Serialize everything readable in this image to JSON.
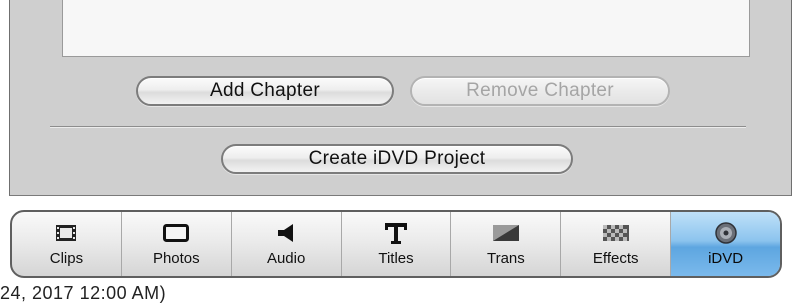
{
  "chapters_panel": {
    "add_chapter_label": "Add Chapter",
    "remove_chapter_label": "Remove Chapter",
    "create_project_label": "Create iDVD Project"
  },
  "toolbar": {
    "tabs": [
      {
        "label": "Clips",
        "icon": "clips-icon"
      },
      {
        "label": "Photos",
        "icon": "photos-icon"
      },
      {
        "label": "Audio",
        "icon": "audio-icon"
      },
      {
        "label": "Titles",
        "icon": "titles-icon"
      },
      {
        "label": "Trans",
        "icon": "transitions-icon"
      },
      {
        "label": "Effects",
        "icon": "effects-icon"
      },
      {
        "label": "iDVD",
        "icon": "idvd-icon",
        "selected": true
      }
    ],
    "accent_color": "#6fb0e6"
  },
  "footer": {
    "text": "24, 2017 12:00 AM)"
  }
}
